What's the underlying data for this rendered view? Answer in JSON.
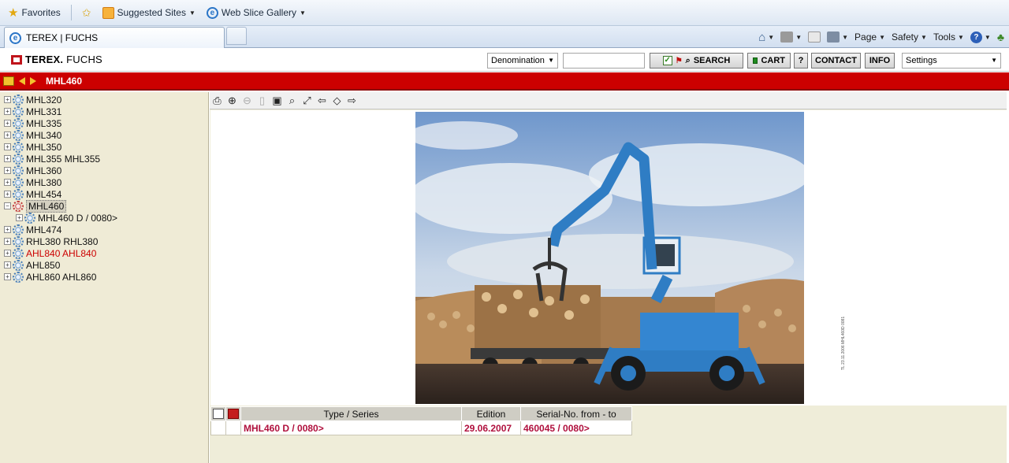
{
  "browser": {
    "favorites_label": "Favorites",
    "suggested_sites_label": "Suggested Sites",
    "web_slice_gallery_label": "Web Slice Gallery",
    "tab_title": "TEREX | FUCHS",
    "commands": {
      "page": "Page",
      "safety": "Safety",
      "tools": "Tools",
      "help": "?"
    }
  },
  "header": {
    "logo_terex": "TEREX.",
    "logo_fuchs": "FUCHS",
    "search_field_select": "Denomination",
    "search_value": "",
    "search_button": "SEARCH",
    "cart_button": "CART",
    "help_button": "?",
    "contact_button": "CONTACT",
    "info_button": "INFO",
    "settings_select": "Settings"
  },
  "path_bar": {
    "current": "MHL460"
  },
  "tree": {
    "items": [
      {
        "label": "MHL320"
      },
      {
        "label": "MHL331"
      },
      {
        "label": "MHL335"
      },
      {
        "label": "MHL340"
      },
      {
        "label": "MHL350"
      },
      {
        "label": "MHL355 MHL355"
      },
      {
        "label": "MHL360"
      },
      {
        "label": "MHL380"
      },
      {
        "label": "MHL454"
      },
      {
        "label": "MHL460"
      },
      {
        "label": "MHL460 D / 0080>"
      },
      {
        "label": "MHL474"
      },
      {
        "label": "RHL380 RHL380"
      },
      {
        "label": "AHL840 AHL840"
      },
      {
        "label": "AHL850"
      },
      {
        "label": "AHL860 AHL860"
      }
    ]
  },
  "image": {
    "caption": "TL 23.11.2006 MHL460D 0081"
  },
  "table": {
    "headers": [
      "Type / Series",
      "Edition",
      "Serial-No. from - to"
    ],
    "rows": [
      {
        "type": "MHL460 D / 0080>",
        "edition": "29.06.2007",
        "serial": "460045 / 0080>"
      }
    ]
  },
  "colors": {
    "brand_red": "#cc0000",
    "sidebar_bg": "#efebd6",
    "row_text": "#b0103d"
  }
}
